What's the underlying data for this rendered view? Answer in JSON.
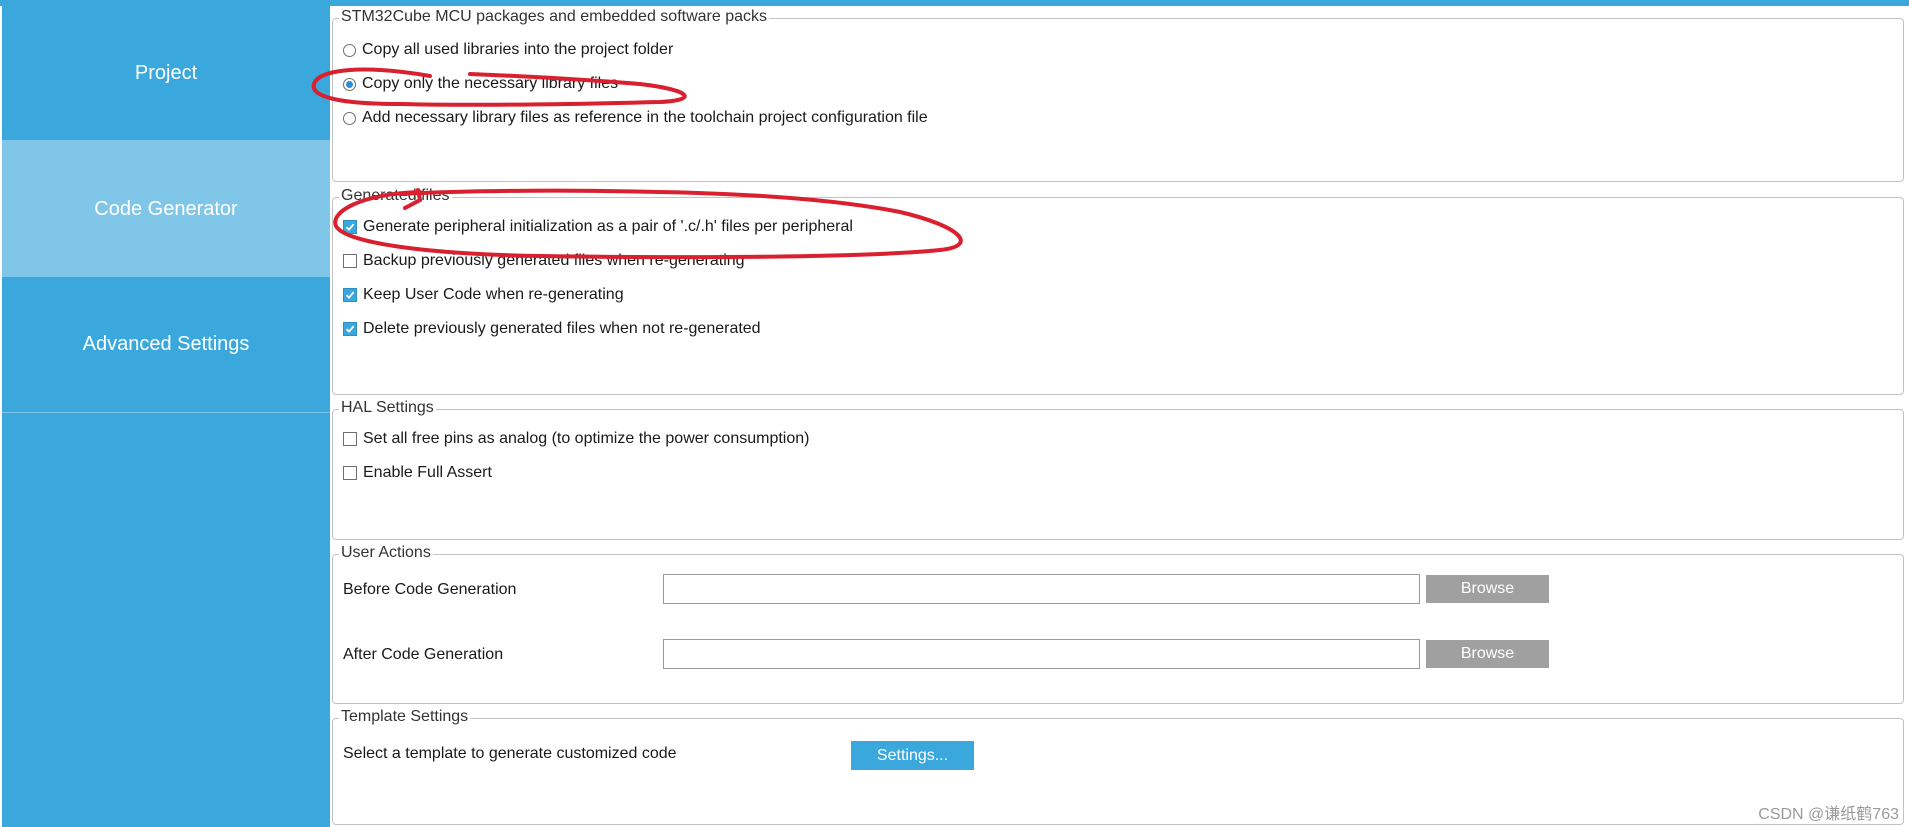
{
  "sidebar": {
    "items": [
      {
        "label": "Project",
        "active": false
      },
      {
        "label": "Code Generator",
        "active": true
      },
      {
        "label": "Advanced Settings",
        "active": false
      }
    ]
  },
  "packages": {
    "title": "STM32Cube MCU packages and embedded software packs",
    "options": [
      {
        "label": "Copy all used libraries into the project folder",
        "selected": false
      },
      {
        "label": "Copy only the necessary library files",
        "selected": true
      },
      {
        "label": "Add necessary library files as reference in the toolchain project configuration file",
        "selected": false
      }
    ]
  },
  "generated_files": {
    "title": "Generated files",
    "options": [
      {
        "label": "Generate peripheral initialization as a pair of '.c/.h' files per peripheral",
        "checked": true
      },
      {
        "label": "Backup previously generated files when re-generating",
        "checked": false
      },
      {
        "label": "Keep User Code when re-generating",
        "checked": true
      },
      {
        "label": "Delete previously generated files when not re-generated",
        "checked": true
      }
    ]
  },
  "hal_settings": {
    "title": "HAL Settings",
    "options": [
      {
        "label": "Set all free pins as analog (to optimize the power consumption)",
        "checked": false
      },
      {
        "label": "Enable Full Assert",
        "checked": false
      }
    ]
  },
  "user_actions": {
    "title": "User Actions",
    "before_label": "Before Code Generation",
    "before_value": "",
    "after_label": "After Code Generation",
    "after_value": "",
    "browse_label": "Browse"
  },
  "template_settings": {
    "title": "Template Settings",
    "description": "Select a template to generate customized code",
    "button_label": "Settings..."
  },
  "watermark": "CSDN @谦纸鹤763",
  "colors": {
    "accent": "#3aa8dc",
    "active_nav": "#7fc6e9",
    "annotation": "#d9202f"
  }
}
